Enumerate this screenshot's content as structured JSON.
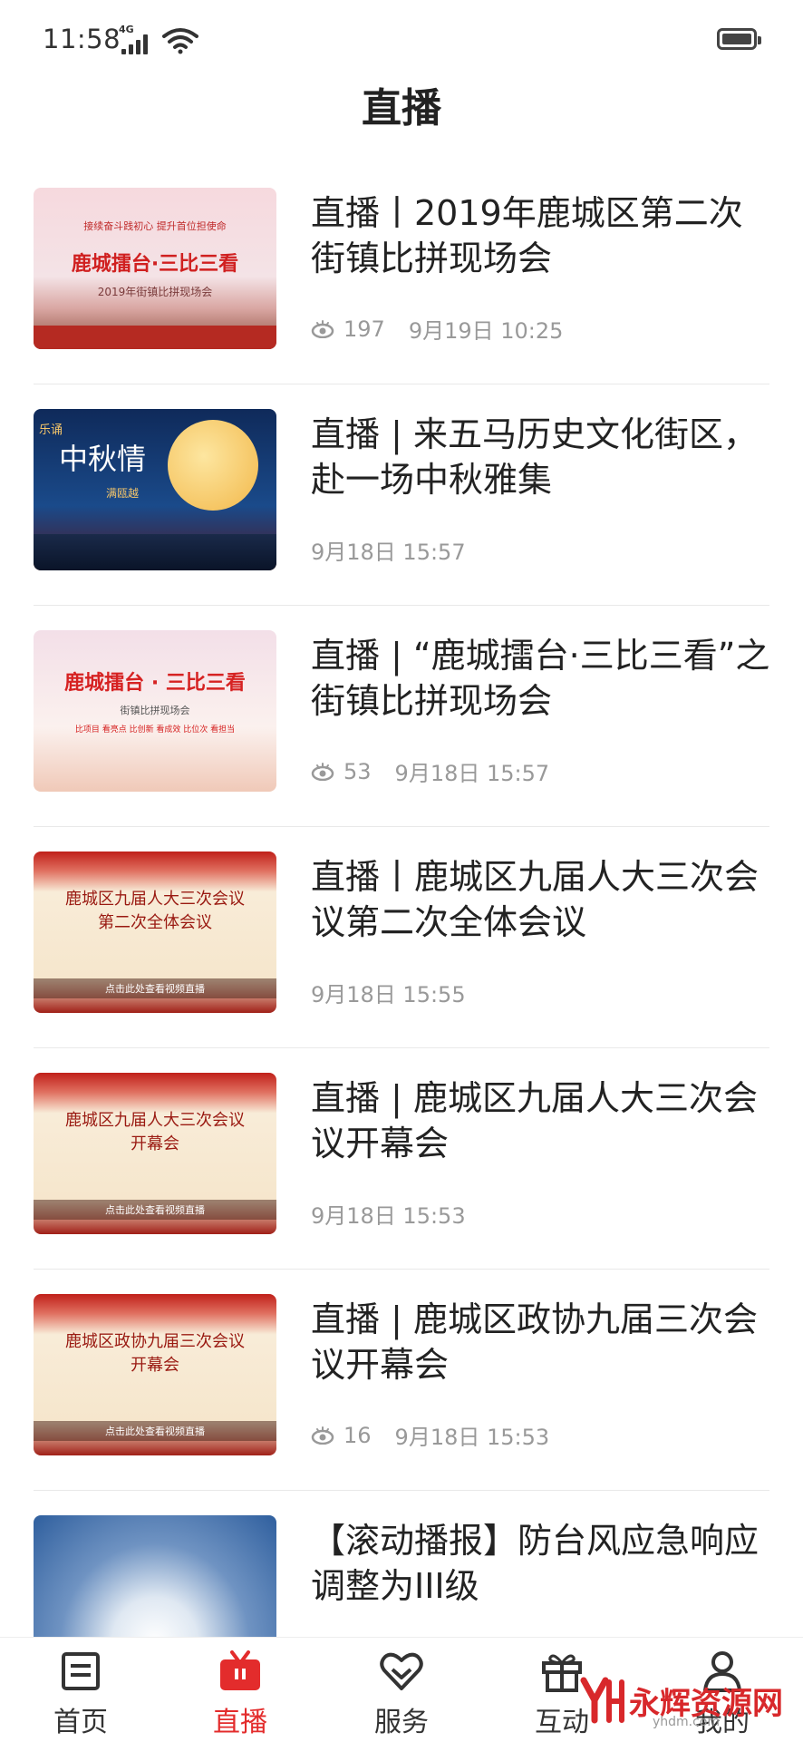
{
  "status_bar": {
    "time": "11:58",
    "network": "4G"
  },
  "header": {
    "title": "直播"
  },
  "items": [
    {
      "title": "直播丨2019年鹿城区第二次街镇比拼现场会",
      "views": "197",
      "date": "9月19日 10:25",
      "thumb": {
        "line1": "接续奋斗践初心 提升首位担使命",
        "line2": "鹿城擂台·三比三看",
        "line3": "2019年街镇比拼现场会"
      }
    },
    {
      "title": "直播 | 来五马历史文化街区，赴一场中秋雅集",
      "views": null,
      "date": "9月18日 15:57",
      "thumb": {
        "line1": "乐诵",
        "line2": "中秋情",
        "line3": "满瓯越"
      }
    },
    {
      "title": "直播 | “鹿城擂台·三比三看”之街镇比拼现场会",
      "views": "53",
      "date": "9月18日 15:57",
      "thumb": {
        "line1": "鹿城擂台 · 三比三看",
        "line2": "街镇比拼现场会",
        "line3": "比项目 看亮点 比创新 看成效 比位次 看担当"
      }
    },
    {
      "title": "直播丨鹿城区九届人大三次会议第二次全体会议",
      "views": null,
      "date": "9月18日 15:55",
      "thumb": {
        "line1": "鹿城区九届人大三次会议",
        "line2": "第二次全体会议",
        "line3": "点击此处查看视频直播"
      }
    },
    {
      "title": "直播 | 鹿城区九届人大三次会议开幕会",
      "views": null,
      "date": "9月18日 15:53",
      "thumb": {
        "line1": "鹿城区九届人大三次会议",
        "line2": "开幕会",
        "line3": "点击此处查看视频直播"
      }
    },
    {
      "title": "直播 | 鹿城区政协九届三次会议开幕会",
      "views": "16",
      "date": "9月18日 15:53",
      "thumb": {
        "line1": "鹿城区政协九届三次会议",
        "line2": "开幕会",
        "line3": "点击此处查看视频直播"
      }
    },
    {
      "title": "【滚动播报】防台风应急响应调整为III级",
      "views": null,
      "date": null,
      "thumb": {
        "line1": "",
        "line2": "",
        "line3": ""
      }
    }
  ],
  "tabbar": [
    {
      "label": "首页",
      "icon": "home-icon"
    },
    {
      "label": "直播",
      "icon": "live-tv-icon",
      "active": true
    },
    {
      "label": "服务",
      "icon": "service-heart-icon"
    },
    {
      "label": "互动",
      "icon": "gift-icon"
    },
    {
      "label": "我的",
      "icon": "user-icon"
    }
  ],
  "watermark": {
    "text": "永辉资源网",
    "url": "yhdm.com"
  },
  "colors": {
    "accent": "#e32c2c",
    "text": "#222222",
    "meta": "#999999"
  }
}
